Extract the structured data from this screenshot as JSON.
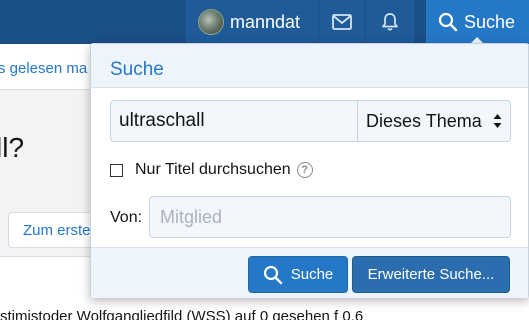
{
  "nav": {
    "username": "manndat",
    "search_label": "Suche",
    "icons": [
      "avatar",
      "envelope-icon",
      "bell-icon",
      "search-icon"
    ]
  },
  "background": {
    "breadcrumb_text": "s gelesen ma",
    "thread_title_fragment": "ll?",
    "first_button_label": "Zum erste",
    "body_text_fragment": "stimistoder Wolfgangliedfild (WSS) auf 0 gesehen f 0.6"
  },
  "search_popup": {
    "header": "Suche",
    "query_value": "ultraschall",
    "scope_selected": "Dieses Thema",
    "title_only_label": "Nur Titel durchsuchen",
    "title_only_checked": false,
    "member_label": "Von:",
    "member_placeholder": "Mitglied",
    "member_value": "",
    "submit_label": "Suche",
    "advanced_label": "Erweiterte Suche..."
  },
  "colors": {
    "nav_bg": "#1a4f87",
    "nav_item_bg": "#1f5b99",
    "accent": "#2577c7",
    "popup_header_bg": "#eef4fb"
  }
}
